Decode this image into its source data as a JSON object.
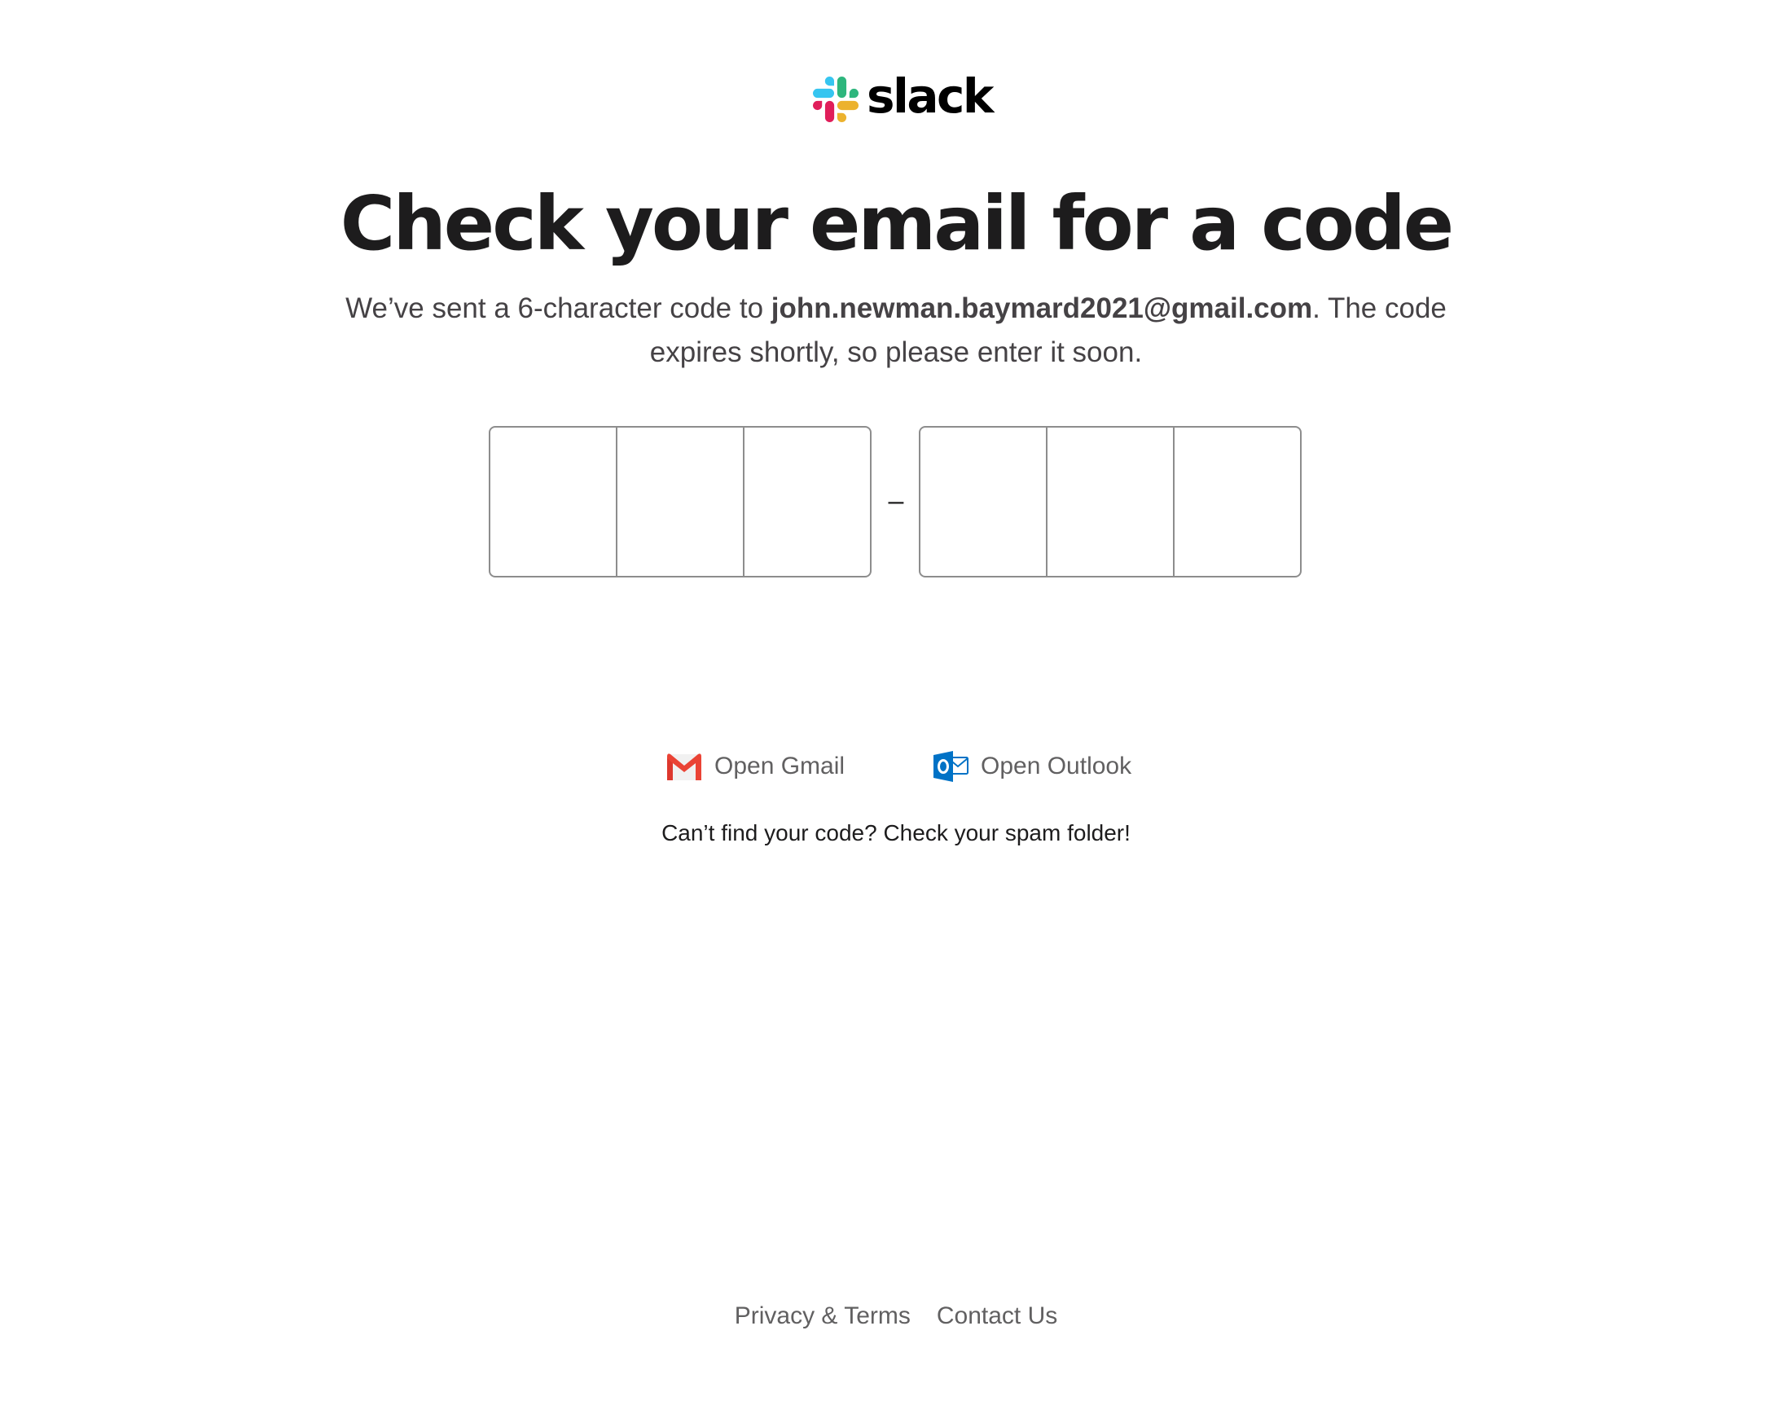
{
  "brand": {
    "name": "slack",
    "logo_icon": "slack-hash-icon",
    "colors": {
      "blue": "#36C5F0",
      "green": "#2EB67D",
      "yellow": "#ECB22E",
      "red": "#E01E5A"
    }
  },
  "heading": {
    "title": "Check your email for a code"
  },
  "message": {
    "prefix": "We’ve sent a 6-character code to ",
    "email": "john.newman.baymard2021@gmail.com",
    "suffix": ". The code expires shortly, so please enter it soon."
  },
  "code_entry": {
    "first_group": [
      "",
      "",
      ""
    ],
    "separator": "–",
    "second_group": [
      "",
      "",
      ""
    ]
  },
  "mail_clients": [
    {
      "label": "Open Gmail",
      "icon": "gmail-icon"
    },
    {
      "label": "Open Outlook",
      "icon": "outlook-icon"
    }
  ],
  "spam_hint": "Can’t find your code? Check your spam folder!",
  "footer": {
    "privacy_label": "Privacy & Terms",
    "contact_label": "Contact Us"
  },
  "colors": {
    "text_primary": "#1d1c1d",
    "text_secondary": "#616061",
    "input_border": "#8d8d8d",
    "gmail_red": "#EA4335",
    "outlook_blue": "#0072C6"
  }
}
